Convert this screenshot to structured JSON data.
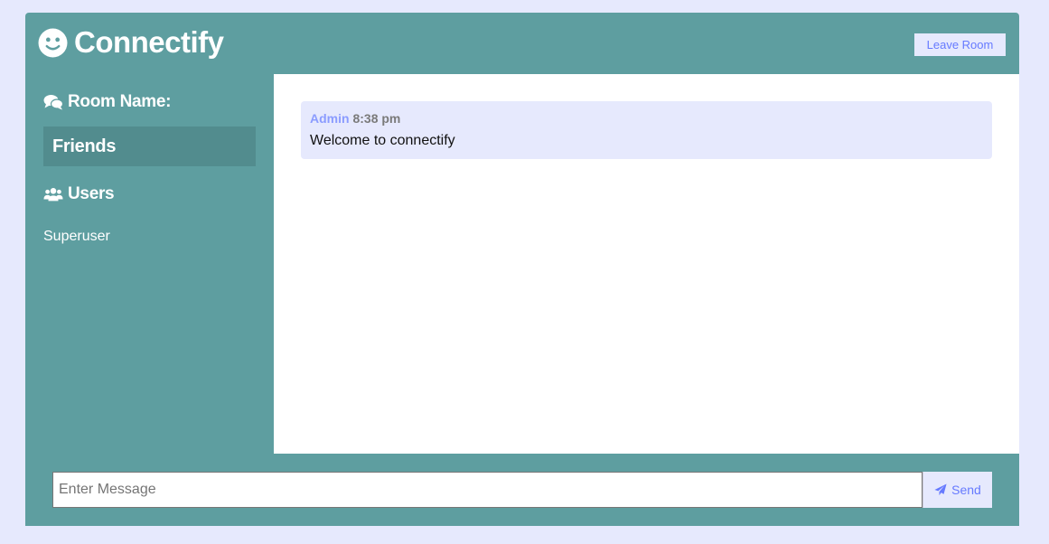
{
  "header": {
    "app_name": "Connectify",
    "logo_icon": "smiley-icon",
    "leave_label": "Leave Room"
  },
  "sidebar": {
    "room_heading": "Room Name:",
    "room_name": "Friends",
    "users_heading": "Users",
    "users": [
      "Superuser"
    ]
  },
  "messages": [
    {
      "author": "Admin",
      "time": "8:38 pm",
      "text": "Welcome to connectify"
    }
  ],
  "form": {
    "placeholder": "Enter Message",
    "value": "",
    "send_label": "Send"
  },
  "colors": {
    "page_bg": "#e6e9fd",
    "container": "#5e9ea0",
    "room_highlight": "#528c8e",
    "accent": "#667aff"
  }
}
